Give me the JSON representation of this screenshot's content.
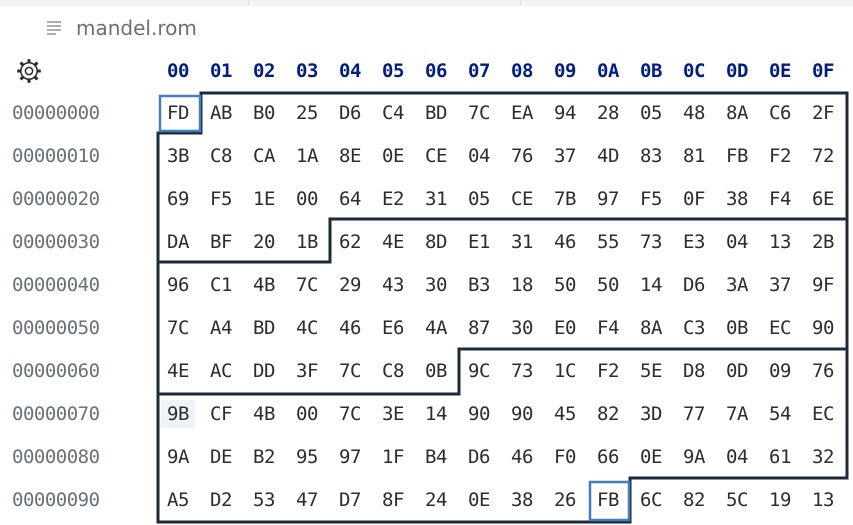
{
  "tab": {
    "filename": "mandel.rom",
    "icon": "text-file-icon"
  },
  "toolbar": {
    "settings_icon": "gear-icon"
  },
  "header": {
    "columns": [
      "00",
      "01",
      "02",
      "03",
      "04",
      "05",
      "06",
      "07",
      "08",
      "09",
      "0A",
      "0B",
      "0C",
      "0D",
      "0E",
      "0F"
    ]
  },
  "rows": [
    {
      "address": "00000000",
      "bytes": [
        "FD",
        "AB",
        "B0",
        "25",
        "D6",
        "C4",
        "BD",
        "7C",
        "EA",
        "94",
        "28",
        "05",
        "48",
        "8A",
        "C6",
        "2F"
      ]
    },
    {
      "address": "00000010",
      "bytes": [
        "3B",
        "C8",
        "CA",
        "1A",
        "8E",
        "0E",
        "CE",
        "04",
        "76",
        "37",
        "4D",
        "83",
        "81",
        "FB",
        "F2",
        "72"
      ]
    },
    {
      "address": "00000020",
      "bytes": [
        "69",
        "F5",
        "1E",
        "00",
        "64",
        "E2",
        "31",
        "05",
        "CE",
        "7B",
        "97",
        "F5",
        "0F",
        "38",
        "F4",
        "6E"
      ]
    },
    {
      "address": "00000030",
      "bytes": [
        "DA",
        "BF",
        "20",
        "1B",
        "62",
        "4E",
        "8D",
        "E1",
        "31",
        "46",
        "55",
        "73",
        "E3",
        "04",
        "13",
        "2B"
      ]
    },
    {
      "address": "00000040",
      "bytes": [
        "96",
        "C1",
        "4B",
        "7C",
        "29",
        "43",
        "30",
        "B3",
        "18",
        "50",
        "50",
        "14",
        "D6",
        "3A",
        "37",
        "9F"
      ]
    },
    {
      "address": "00000050",
      "bytes": [
        "7C",
        "A4",
        "BD",
        "4C",
        "46",
        "E6",
        "4A",
        "87",
        "30",
        "E0",
        "F4",
        "8A",
        "C3",
        "0B",
        "EC",
        "90"
      ]
    },
    {
      "address": "00000060",
      "bytes": [
        "4E",
        "AC",
        "DD",
        "3F",
        "7C",
        "C8",
        "0B",
        "9C",
        "73",
        "1C",
        "F2",
        "5E",
        "D8",
        "0D",
        "09",
        "76"
      ]
    },
    {
      "address": "00000070",
      "bytes": [
        "9B",
        "CF",
        "4B",
        "00",
        "7C",
        "3E",
        "14",
        "90",
        "90",
        "45",
        "82",
        "3D",
        "77",
        "7A",
        "54",
        "EC"
      ]
    },
    {
      "address": "00000080",
      "bytes": [
        "9A",
        "DE",
        "B2",
        "95",
        "97",
        "1F",
        "B4",
        "D6",
        "46",
        "F0",
        "66",
        "0E",
        "9A",
        "04",
        "61",
        "32"
      ]
    },
    {
      "address": "00000090",
      "bytes": [
        "A5",
        "D2",
        "53",
        "47",
        "D7",
        "8F",
        "24",
        "0E",
        "38",
        "26",
        "FB",
        "6C",
        "82",
        "5C",
        "19",
        "13"
      ]
    }
  ],
  "colors": {
    "header_text": "#001d8a",
    "address_text": "#6a7178",
    "region_outline": "#1c2b3a",
    "focus_outline": "#3f7fbf"
  }
}
